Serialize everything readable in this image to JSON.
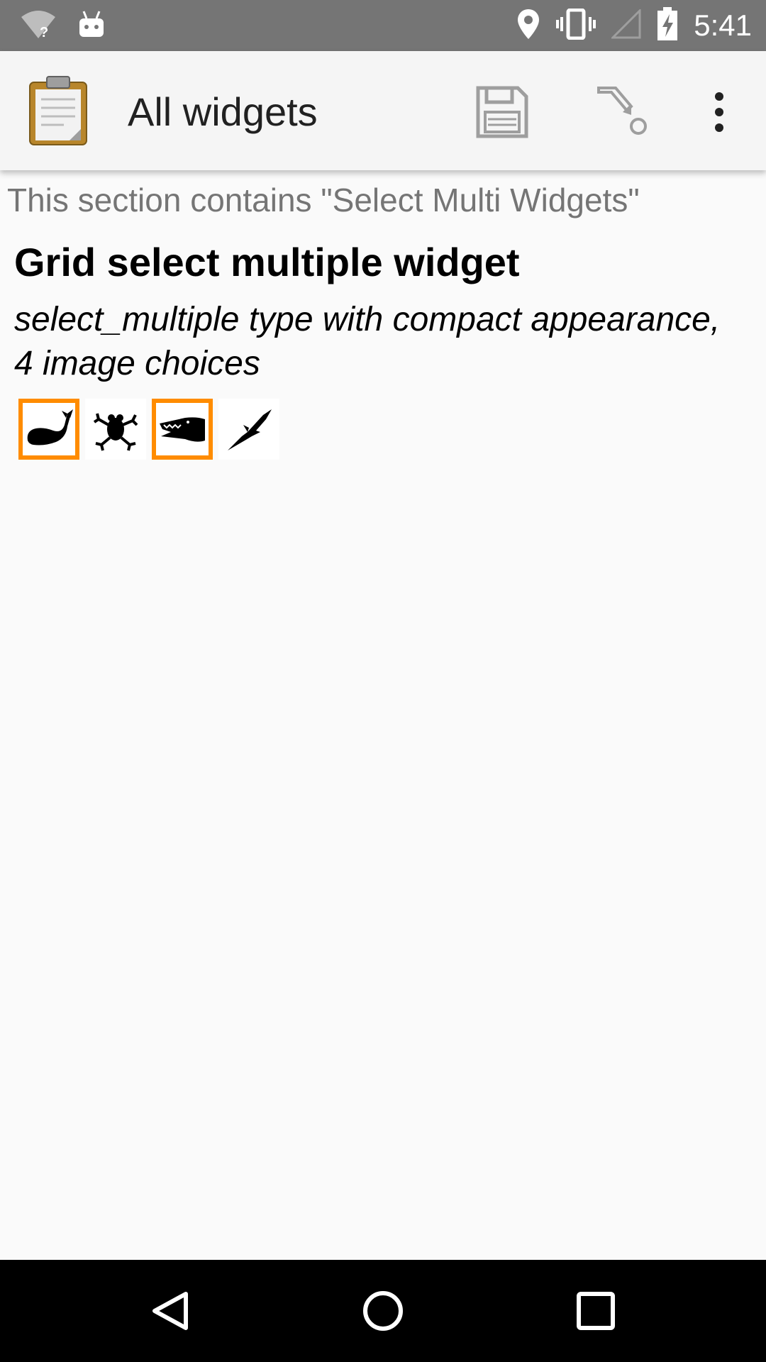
{
  "status_bar": {
    "time": "5:41",
    "icons": [
      "wifi-unknown-icon",
      "android-icon",
      "location-icon",
      "vibrate-icon",
      "signal-icon",
      "battery-charging-icon"
    ],
    "background": "#757575"
  },
  "app_bar": {
    "title": "All widgets",
    "actions": [
      "save-icon",
      "go-to-prompt-icon",
      "overflow-menu-icon"
    ]
  },
  "form": {
    "section_note": "This section contains \"Select Multi Widgets\"",
    "question_label": "Grid select multiple widget",
    "question_hint": "select_multiple type with compact appearance, 4 image choices",
    "choices": [
      {
        "icon": "whale-icon",
        "selected": true
      },
      {
        "icon": "frog-icon",
        "selected": false
      },
      {
        "icon": "crocodile-icon",
        "selected": true
      },
      {
        "icon": "eagle-icon",
        "selected": false
      }
    ],
    "selected_color": "#ff8c00"
  },
  "nav_bar": {
    "buttons": [
      "back-icon",
      "home-icon",
      "recents-icon"
    ]
  }
}
